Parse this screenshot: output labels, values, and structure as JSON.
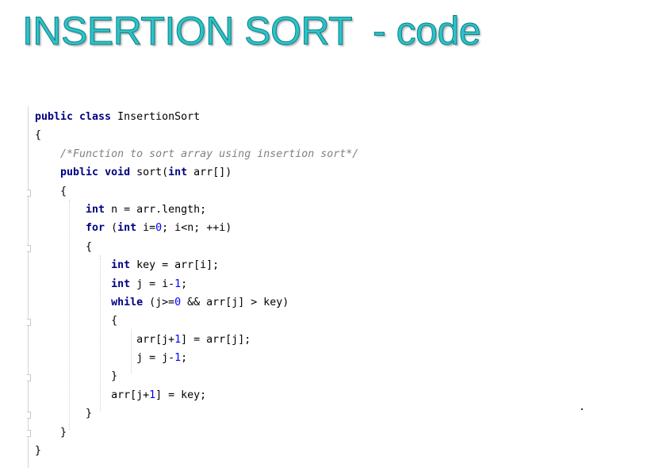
{
  "slide": {
    "title": "INSERTION SORT  - code"
  },
  "code": {
    "lines": [
      [
        {
          "t": "public class",
          "k": "kw"
        },
        {
          "t": " InsertionSort",
          "k": "tx"
        }
      ],
      [
        {
          "t": "{",
          "k": "tx"
        }
      ],
      [
        {
          "t": "    ",
          "k": "tx"
        },
        {
          "t": "/*Function to sort array using insertion sort*/",
          "k": "cm"
        }
      ],
      [
        {
          "t": "    ",
          "k": "tx"
        },
        {
          "t": "public void",
          "k": "kw"
        },
        {
          "t": " sort(",
          "k": "tx"
        },
        {
          "t": "int",
          "k": "kw"
        },
        {
          "t": " arr[])",
          "k": "tx"
        }
      ],
      [
        {
          "t": "    {",
          "k": "tx"
        }
      ],
      [
        {
          "t": "        ",
          "k": "tx"
        },
        {
          "t": "int",
          "k": "kw"
        },
        {
          "t": " n = arr.length;",
          "k": "tx"
        }
      ],
      [
        {
          "t": "        ",
          "k": "tx"
        },
        {
          "t": "for",
          "k": "kw"
        },
        {
          "t": " (",
          "k": "tx"
        },
        {
          "t": "int",
          "k": "kw"
        },
        {
          "t": " i=",
          "k": "tx"
        },
        {
          "t": "0",
          "k": "num"
        },
        {
          "t": "; i<n; ++i)",
          "k": "tx"
        }
      ],
      [
        {
          "t": "        {",
          "k": "tx"
        }
      ],
      [
        {
          "t": "            ",
          "k": "tx"
        },
        {
          "t": "int",
          "k": "kw"
        },
        {
          "t": " key = arr[i];",
          "k": "tx"
        }
      ],
      [
        {
          "t": "            ",
          "k": "tx"
        },
        {
          "t": "int",
          "k": "kw"
        },
        {
          "t": " j = i-",
          "k": "tx"
        },
        {
          "t": "1",
          "k": "num"
        },
        {
          "t": ";",
          "k": "tx"
        }
      ],
      [
        {
          "t": "            ",
          "k": "tx"
        },
        {
          "t": "while",
          "k": "kw"
        },
        {
          "t": " (j>=",
          "k": "tx"
        },
        {
          "t": "0",
          "k": "num"
        },
        {
          "t": " && arr[j] > key)",
          "k": "tx"
        }
      ],
      [
        {
          "t": "            {",
          "k": "tx"
        }
      ],
      [
        {
          "t": "                arr[j+",
          "k": "tx"
        },
        {
          "t": "1",
          "k": "num"
        },
        {
          "t": "] = arr[j];",
          "k": "tx"
        }
      ],
      [
        {
          "t": "                j = j-",
          "k": "tx"
        },
        {
          "t": "1",
          "k": "num"
        },
        {
          "t": ";",
          "k": "tx"
        }
      ],
      [
        {
          "t": "            }",
          "k": "tx"
        }
      ],
      [
        {
          "t": "            arr[j+",
          "k": "tx"
        },
        {
          "t": "1",
          "k": "num"
        },
        {
          "t": "] = key;",
          "k": "tx"
        }
      ],
      [
        {
          "t": "        }",
          "k": "tx"
        }
      ],
      [
        {
          "t": "    }",
          "k": "tx"
        }
      ],
      [
        {
          "t": "}",
          "k": "tx"
        }
      ]
    ]
  },
  "colors": {
    "title": "#2cc3c7",
    "title_outline": "#0e7f86",
    "keyword": "#000080",
    "comment": "#808080",
    "number": "#0000ff",
    "text": "#000000"
  }
}
